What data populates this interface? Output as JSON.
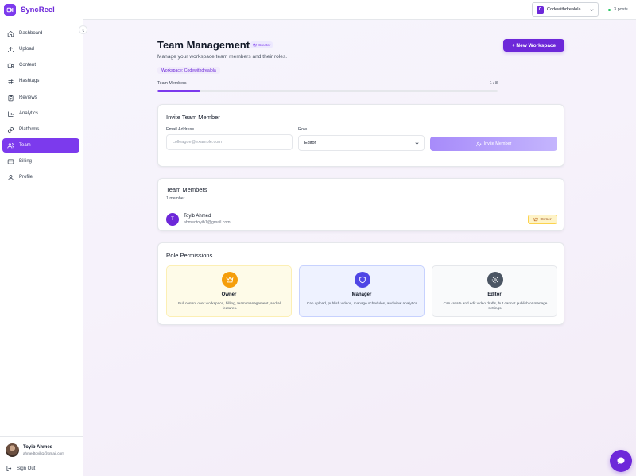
{
  "brand": {
    "name": "SyncReel",
    "logo_icon": "video-camera-icon",
    "accent": "#7c3aed"
  },
  "sidebar": {
    "items": [
      {
        "label": "Dashboard",
        "icon": "home-icon",
        "active": false
      },
      {
        "label": "Upload",
        "icon": "upload-icon",
        "active": false
      },
      {
        "label": "Content",
        "icon": "video-icon",
        "active": false
      },
      {
        "label": "Hashtags",
        "icon": "hash-icon",
        "active": false
      },
      {
        "label": "Reviews",
        "icon": "clipboard-icon",
        "active": false
      },
      {
        "label": "Analytics",
        "icon": "bar-chart-icon",
        "active": false
      },
      {
        "label": "Platforms",
        "icon": "link-icon",
        "active": false
      },
      {
        "label": "Team",
        "icon": "users-icon",
        "active": true
      },
      {
        "label": "Billing",
        "icon": "credit-card-icon",
        "active": false
      },
      {
        "label": "Profile",
        "icon": "user-icon",
        "active": false
      }
    ],
    "user": {
      "name": "Toyib Ahmed",
      "email": "ahmedtoyib1@gmail.com"
    },
    "sign_out": "Sign Out"
  },
  "topbar": {
    "workspace": {
      "initial": "C",
      "name": "Codewithdrealola"
    },
    "posts": "3 posts",
    "posts_status_color": "#22c55e"
  },
  "header": {
    "title": "Team Management",
    "plan_badge": "Creator",
    "subtitle": "Manage your workspace team members and their roles.",
    "workspace_chip": "Workspace: Codewithdrealola",
    "new_workspace_button": "+ New Workspace",
    "members_label": "Team Members",
    "members_count": "1 / 8",
    "members_used": 1,
    "members_limit": 8
  },
  "invite": {
    "title": "Invite Team Member",
    "email_label": "Email Address",
    "email_placeholder": "colleague@example.com",
    "role_label": "Role",
    "role_value": "Editor",
    "button": "Invite Member"
  },
  "members": {
    "title": "Team Members",
    "count": "1 member",
    "list": [
      {
        "initial": "T",
        "name": "Toyib Ahmed",
        "email": "ahmedtoyib1@gmail.com",
        "role": "Owner"
      }
    ]
  },
  "permissions": {
    "title": "Role Permissions",
    "roles": [
      {
        "name": "Owner",
        "icon": "crown-icon",
        "description": "Full control over workspace, billing, team management, and all features.",
        "bg": "#fefbe8",
        "border": "#fcefb4",
        "icon_bg": "#f59e0b"
      },
      {
        "name": "Manager",
        "icon": "shield-icon",
        "description": "Can upload, publish videos, manage schedules, and view analytics.",
        "bg": "#eef2ff",
        "border": "#c7d2fe",
        "icon_bg": "#4f46e5"
      },
      {
        "name": "Editor",
        "icon": "gear-icon",
        "description": "Can create and edit video drafts, but cannot publish or manage settings.",
        "bg": "#f9fafb",
        "border": "#e5e7eb",
        "icon_bg": "#4b5563"
      }
    ]
  }
}
